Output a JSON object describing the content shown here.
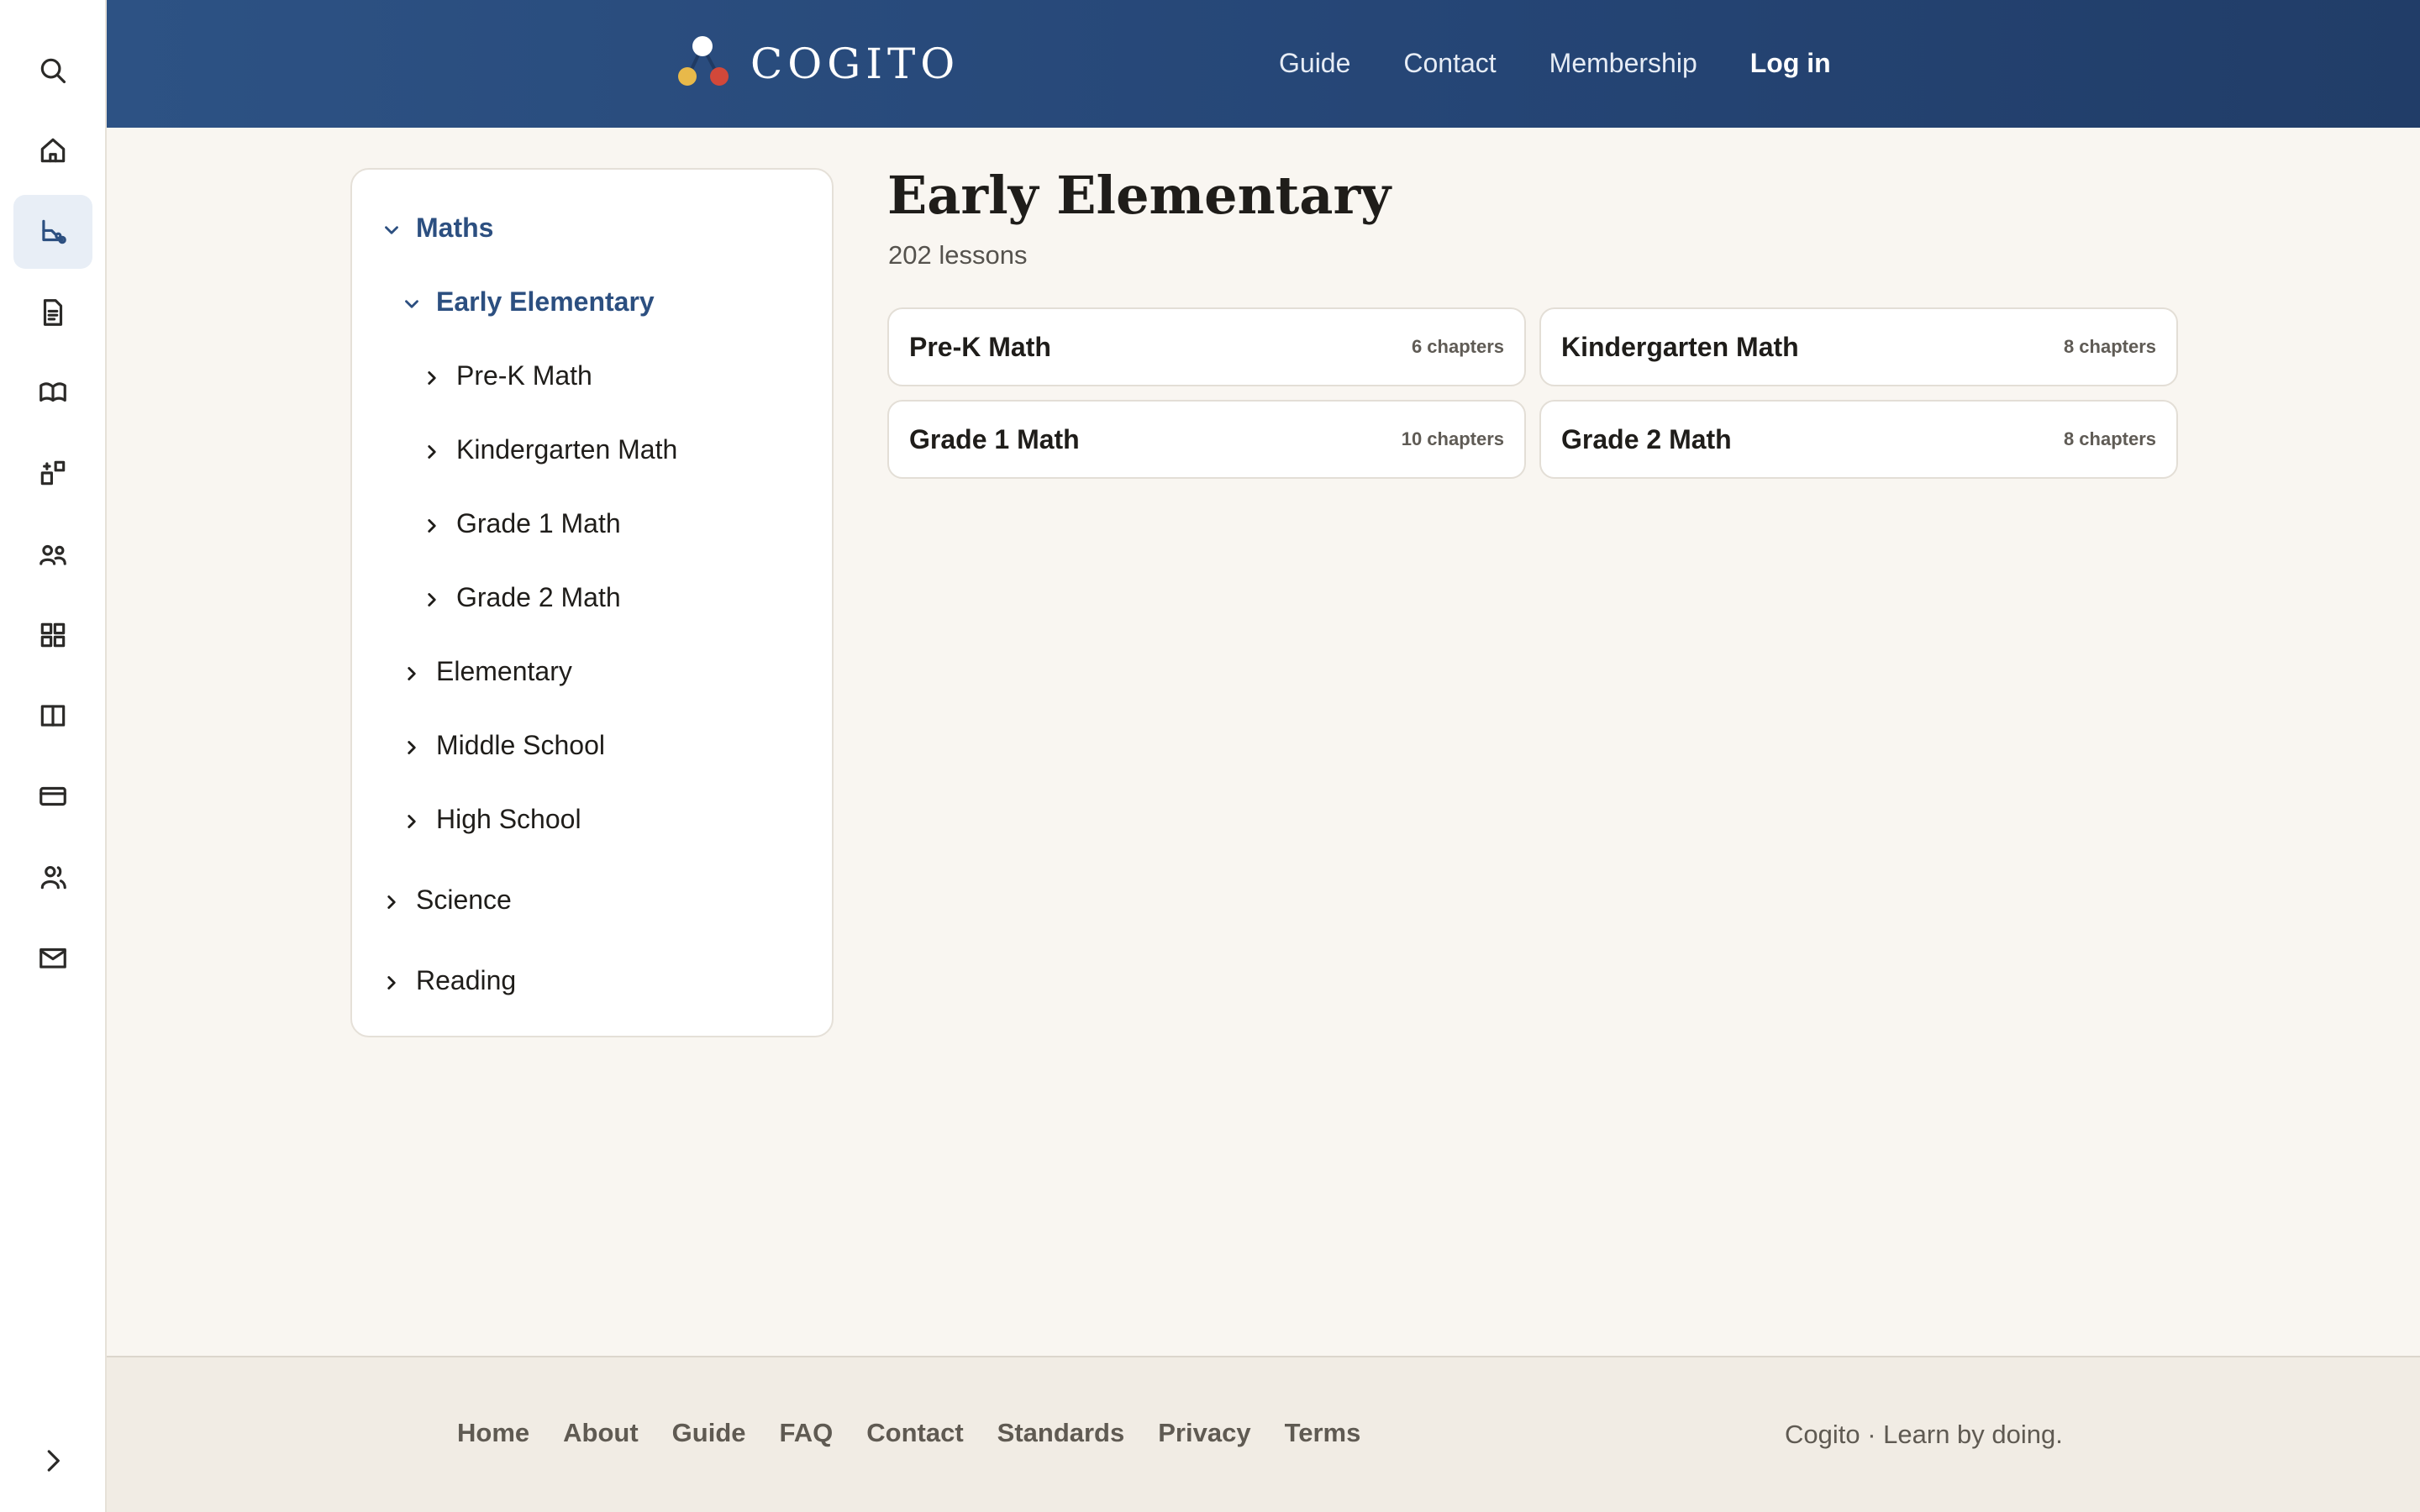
{
  "rail": {
    "items": [
      {
        "icon": "search-icon"
      },
      {
        "icon": "home-icon"
      },
      {
        "icon": "curriculum-icon",
        "active": true
      },
      {
        "icon": "document-icon"
      },
      {
        "icon": "open-book-icon"
      },
      {
        "icon": "shapes-icon"
      },
      {
        "icon": "users-icon"
      },
      {
        "icon": "grid-icon"
      },
      {
        "icon": "columns-icon"
      },
      {
        "icon": "card-icon"
      },
      {
        "icon": "people-icon"
      },
      {
        "icon": "mail-icon"
      }
    ],
    "expand_icon": "chevron-right-icon"
  },
  "header": {
    "logo_text": "COGITO",
    "nav": {
      "guide": "Guide",
      "contact": "Contact",
      "membership": "Membership",
      "login": "Log in"
    },
    "colors": {
      "header": "#2d5284",
      "logo_yellow": "#e8b94a",
      "logo_red": "#d2483a"
    }
  },
  "tree": {
    "maths": "Maths",
    "early_elementary": "Early Elementary",
    "pre_k": "Pre-K Math",
    "kindergarten": "Kindergarten Math",
    "grade1": "Grade 1 Math",
    "grade2": "Grade 2 Math",
    "elementary": "Elementary",
    "middle_school": "Middle School",
    "high_school": "High School",
    "science": "Science",
    "reading": "Reading"
  },
  "main": {
    "title": "Early Elementary",
    "lesson_count": "202 lessons",
    "cards": [
      {
        "title": "Pre-K Math",
        "meta": "6 chapters"
      },
      {
        "title": "Kindergarten Math",
        "meta": "8 chapters"
      },
      {
        "title": "Grade 1 Math",
        "meta": "10 chapters"
      },
      {
        "title": "Grade 2 Math",
        "meta": "8 chapters"
      }
    ]
  },
  "footer": {
    "links": {
      "home": "Home",
      "about": "About",
      "guide": "Guide",
      "faq": "FAQ",
      "contact": "Contact",
      "standards": "Standards",
      "privacy": "Privacy",
      "terms": "Terms"
    },
    "tagline": "Cogito · Learn by doing."
  }
}
